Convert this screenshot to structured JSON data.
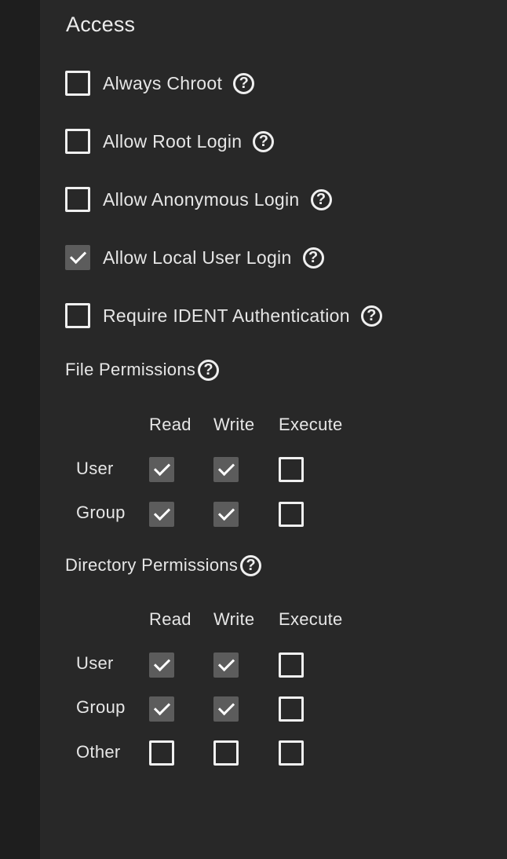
{
  "access": {
    "title": "Access",
    "options": [
      {
        "label": "Always Chroot",
        "checked": false
      },
      {
        "label": "Allow Root Login",
        "checked": false
      },
      {
        "label": "Allow Anonymous Login",
        "checked": false
      },
      {
        "label": "Allow Local User Login",
        "checked": true
      },
      {
        "label": "Require IDENT Authentication",
        "checked": false
      }
    ]
  },
  "help_glyph": "?",
  "file_permissions": {
    "title": "File Permissions",
    "columns": [
      "Read",
      "Write",
      "Execute"
    ],
    "rows": [
      {
        "label": "User",
        "values": [
          true,
          true,
          false
        ]
      },
      {
        "label": "Group",
        "values": [
          true,
          true,
          false
        ]
      }
    ]
  },
  "directory_permissions": {
    "title": "Directory Permissions",
    "columns": [
      "Read",
      "Write",
      "Execute"
    ],
    "rows": [
      {
        "label": "User",
        "values": [
          true,
          true,
          false
        ]
      },
      {
        "label": "Group",
        "values": [
          true,
          true,
          false
        ]
      },
      {
        "label": "Other",
        "values": [
          false,
          false,
          false
        ]
      }
    ]
  },
  "colors": {
    "background": "#282828",
    "sidebar": "#1e1e1e",
    "text": "#e6e6e6",
    "checked_fill": "#5c5c5c"
  },
  "icons": {
    "help": "help-circle-icon",
    "check": "checkmark-icon"
  }
}
